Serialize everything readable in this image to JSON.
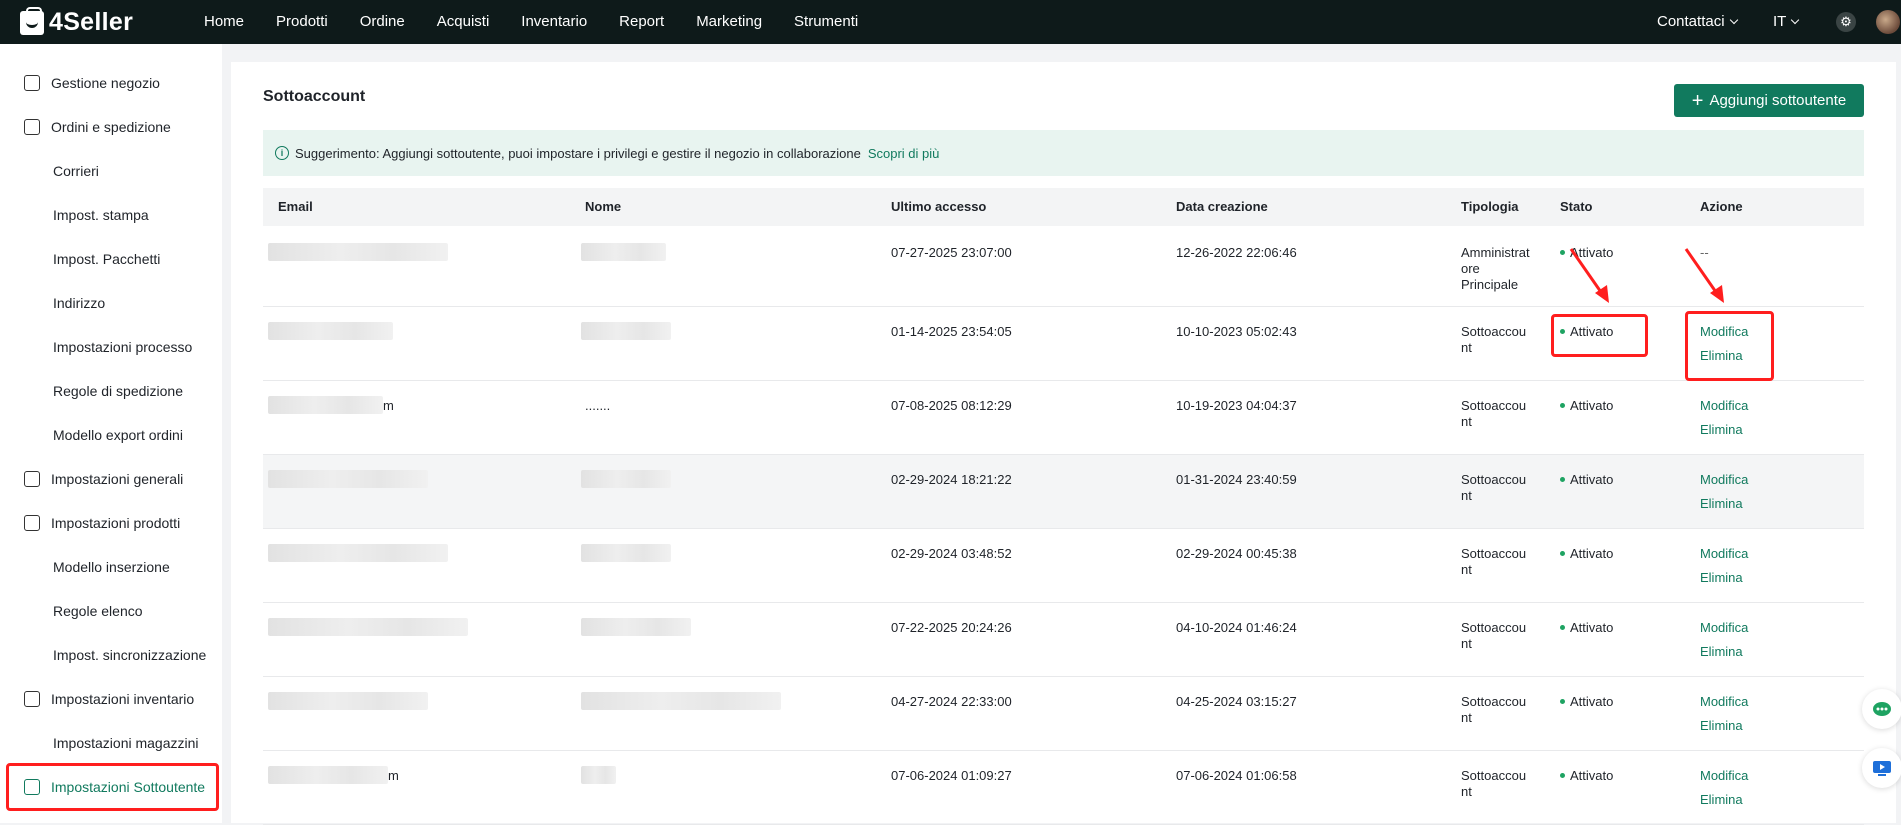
{
  "app": {
    "name": "4Seller"
  },
  "nav": [
    "Home",
    "Prodotti",
    "Ordine",
    "Acquisti",
    "Inventario",
    "Report",
    "Marketing",
    "Strumenti"
  ],
  "header": {
    "contact": "Contattaci",
    "language": "IT"
  },
  "sidebar": {
    "items": [
      {
        "label": "Gestione negozio",
        "icon": "store-icon",
        "type": "group"
      },
      {
        "label": "Ordini e spedizione",
        "icon": "clipboard-icon",
        "type": "group"
      },
      {
        "label": "Corrieri",
        "type": "sub"
      },
      {
        "label": "Impost. stampa",
        "type": "sub"
      },
      {
        "label": "Impost. Pacchetti",
        "type": "sub"
      },
      {
        "label": "Indirizzo",
        "type": "sub"
      },
      {
        "label": "Impostazioni processo",
        "type": "sub"
      },
      {
        "label": "Regole di spedizione",
        "type": "sub"
      },
      {
        "label": "Modello export ordini",
        "type": "sub"
      },
      {
        "label": "Impostazioni generali",
        "icon": "printer-icon",
        "type": "group"
      },
      {
        "label": "Impostazioni prodotti",
        "icon": "upload-box-icon",
        "type": "group"
      },
      {
        "label": "Modello inserzione",
        "type": "sub"
      },
      {
        "label": "Regole elenco",
        "type": "sub"
      },
      {
        "label": "Impost. sincronizzazione",
        "type": "sub"
      },
      {
        "label": "Impostazioni inventario",
        "icon": "inventory-icon",
        "type": "group"
      },
      {
        "label": "Impostazioni magazzini",
        "type": "sub"
      },
      {
        "label": "Impostazioni Sottoutente",
        "icon": "user-badge-icon",
        "type": "group",
        "active": true
      }
    ]
  },
  "page": {
    "title": "Sottoaccount",
    "add_button": "Aggiungi sottoutente",
    "tip_text": "Suggerimento: Aggiungi sottoutente, puoi impostare i privilegi e gestire il negozio in collaborazione",
    "tip_link": "Scopri di più"
  },
  "table": {
    "columns": [
      "Email",
      "Nome",
      "Ultimo accesso",
      "Data creazione",
      "Tipologia",
      "Stato",
      "Azione"
    ],
    "rows": [
      {
        "email_suffix": "",
        "name_text": "",
        "last_access": "07-27-2025 23:07:00",
        "created": "12-26-2022 22:06:46",
        "type": "Amministrat ore Principale",
        "status": "Attivato",
        "actions": [
          "--"
        ]
      },
      {
        "email_suffix": "",
        "name_text": "",
        "last_access": "01-14-2025 23:54:05",
        "created": "10-10-2023 05:02:43",
        "type": "Sottoaccou nt",
        "status": "Attivato",
        "actions": [
          "Modifica",
          "Elimina"
        ]
      },
      {
        "email_suffix": "m",
        "name_text": ".......",
        "last_access": "07-08-2025 08:12:29",
        "created": "10-19-2023 04:04:37",
        "type": "Sottoaccou nt",
        "status": "Attivato",
        "actions": [
          "Modifica",
          "Elimina"
        ]
      },
      {
        "email_suffix": "",
        "name_text": "",
        "last_access": "02-29-2024 18:21:22",
        "created": "01-31-2024 23:40:59",
        "type": "Sottoaccou nt",
        "status": "Attivato",
        "actions": [
          "Modifica",
          "Elimina"
        ]
      },
      {
        "email_suffix": "",
        "name_text": "",
        "last_access": "02-29-2024 03:48:52",
        "created": "02-29-2024 00:45:38",
        "type": "Sottoaccou nt",
        "status": "Attivato",
        "actions": [
          "Modifica",
          "Elimina"
        ]
      },
      {
        "email_suffix": "",
        "name_text": "",
        "last_access": "07-22-2025 20:24:26",
        "created": "04-10-2024 01:46:24",
        "type": "Sottoaccou nt",
        "status": "Attivato",
        "actions": [
          "Modifica",
          "Elimina"
        ]
      },
      {
        "email_suffix": "",
        "name_text": "",
        "last_access": "04-27-2024 22:33:00",
        "created": "04-25-2024 03:15:27",
        "type": "Sottoaccou nt",
        "status": "Attivato",
        "actions": [
          "Modifica",
          "Elimina"
        ]
      },
      {
        "email_suffix": "m",
        "name_text": "",
        "last_access": "07-06-2024 01:09:27",
        "created": "07-06-2024 01:06:58",
        "type": "Sottoaccou nt",
        "status": "Attivato",
        "actions": [
          "Modifica",
          "Elimina"
        ]
      }
    ]
  },
  "colors": {
    "brand": "#117a5e",
    "topbar": "#0e1a1a",
    "highlight": "#ff1e1e",
    "status_dot": "#1ea362"
  }
}
